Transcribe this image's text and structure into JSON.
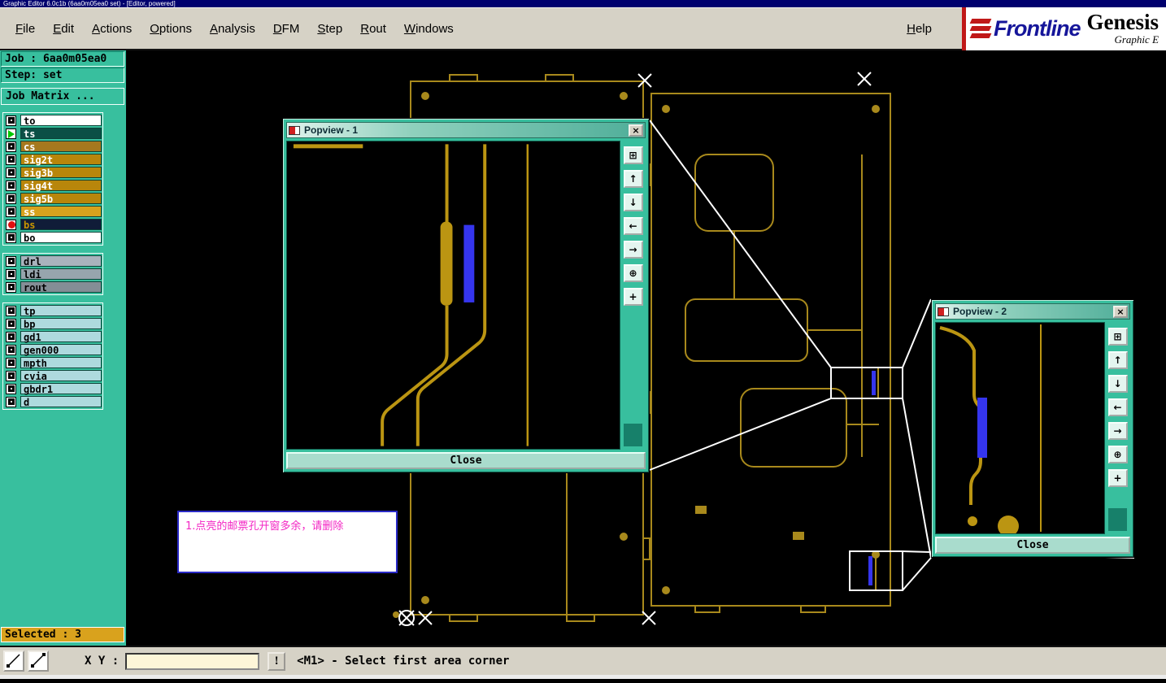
{
  "titlebar": {
    "title": "Graphic Editor 6.0c1b (6aa0m05ea0 set) - [Editor, powered]"
  },
  "menubar": {
    "items": [
      "File",
      "Edit",
      "Actions",
      "Options",
      "Analysis",
      "DFM",
      "Step",
      "Rout",
      "Windows"
    ],
    "help": "Help"
  },
  "logo": {
    "brand": "Frontline",
    "product": "Genesis",
    "tagline": "Graphic E"
  },
  "chrome": {
    "close_x": "×"
  },
  "sidebar": {
    "job": "Job : 6aa0m05ea0",
    "step": "Step: set",
    "job_matrix": "Job Matrix ...",
    "layers1": [
      {
        "name": "to",
        "bg": "#ffffff",
        "fg": "#000000"
      },
      {
        "name": "ts",
        "bg": "#0b4f46",
        "fg": "#ffffff",
        "active": true
      },
      {
        "name": "cs",
        "bg": "#a6781e",
        "fg": "#ffffff"
      },
      {
        "name": "sig2t",
        "bg": "#b8860b",
        "fg": "#ffffff"
      },
      {
        "name": "sig3b",
        "bg": "#b8860b",
        "fg": "#ffffff"
      },
      {
        "name": "sig4t",
        "bg": "#b8860b",
        "fg": "#ffffff"
      },
      {
        "name": "sig5b",
        "bg": "#b8860b",
        "fg": "#ffffff"
      },
      {
        "name": "ss",
        "bg": "#d7a21d",
        "fg": "#ffffff"
      },
      {
        "name": "bs",
        "bg": "#101c38",
        "fg": "#c89600",
        "marker": "red-dot"
      },
      {
        "name": "bo",
        "bg": "#ffffff",
        "fg": "#000000"
      }
    ],
    "layers2": [
      {
        "name": "drl",
        "bg": "#a9b3bd",
        "fg": "#000000"
      },
      {
        "name": "ldi",
        "bg": "#97a5ad",
        "fg": "#000000"
      },
      {
        "name": "rout",
        "bg": "#848e96",
        "fg": "#000000"
      }
    ],
    "layers3": [
      {
        "name": "tp",
        "bg": "#aedade",
        "fg": "#000000"
      },
      {
        "name": "bp",
        "bg": "#aedade",
        "fg": "#000000"
      },
      {
        "name": "gd1",
        "bg": "#aedade",
        "fg": "#000000"
      },
      {
        "name": "gen000",
        "bg": "#aedade",
        "fg": "#000000"
      },
      {
        "name": "mpth",
        "bg": "#aedade",
        "fg": "#000000"
      },
      {
        "name": "cvia",
        "bg": "#aedade",
        "fg": "#000000"
      },
      {
        "name": "gbdr1",
        "bg": "#aedade",
        "fg": "#000000"
      },
      {
        "name": "d",
        "bg": "#aedade",
        "fg": "#000000"
      }
    ]
  },
  "popview1": {
    "title": "Popview - 1",
    "close": "Close"
  },
  "popview2": {
    "title": "Popview - 2",
    "close": "Close"
  },
  "popview_tools": [
    {
      "icon": "restore-window-icon",
      "glyph": "⊞"
    },
    {
      "icon": "pan-up-icon",
      "glyph": "↑"
    },
    {
      "icon": "pan-down-icon",
      "glyph": "↓"
    },
    {
      "icon": "pan-left-icon",
      "glyph": "←"
    },
    {
      "icon": "pan-right-icon",
      "glyph": "→"
    },
    {
      "icon": "zoom-select-icon",
      "glyph": "⊕"
    },
    {
      "icon": "pan-all-icon",
      "glyph": "+"
    }
  ],
  "note": {
    "line1": "1.点亮的邮票孔开窗多余，请删除"
  },
  "statusbar": {
    "selected": "Selected : 3",
    "xy_label": "X Y :",
    "xy_value": "",
    "alert": "!",
    "prompt": "<M1> - Select first area corner"
  },
  "colors": {
    "teal": "#38bf9e",
    "pcb_gold": "#a8891c",
    "highlight_blue": "#3535ee",
    "note_pink": "#f327c4",
    "selected_gold": "#d9a21d"
  }
}
